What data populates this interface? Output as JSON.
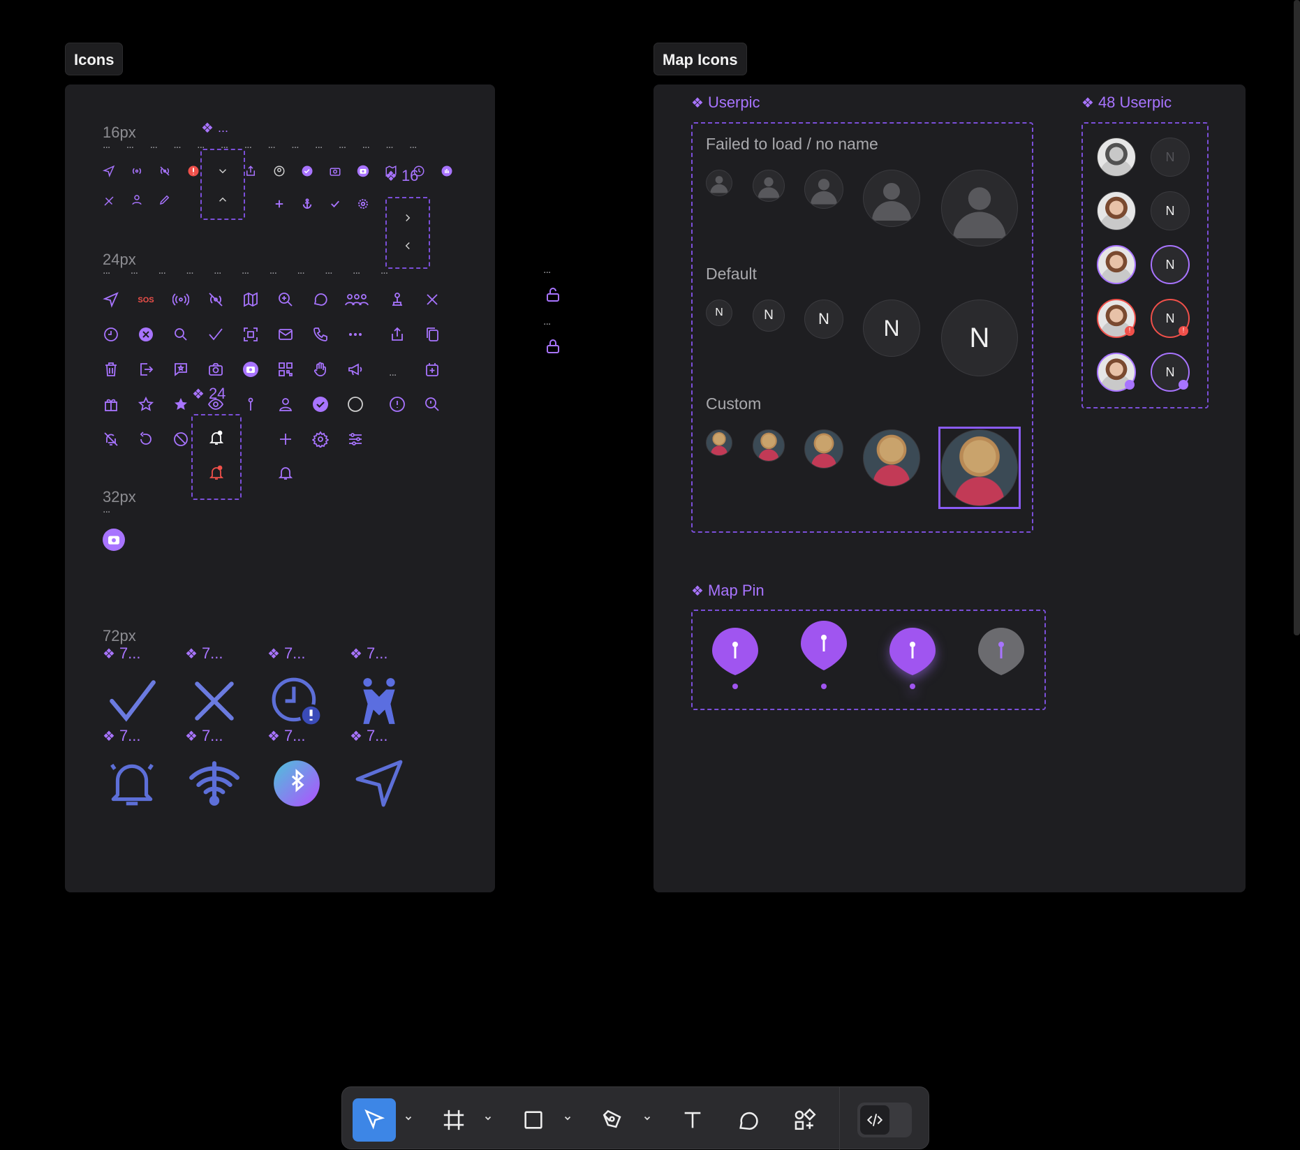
{
  "frames": {
    "icons": {
      "label": "Icons"
    },
    "map_icons": {
      "label": "Map Icons"
    }
  },
  "icons_frame": {
    "size_16": "16px",
    "size_24": "24px",
    "size_32": "32px",
    "size_72": "72px",
    "dots": "...",
    "comp_16_label": "16",
    "comp_24_label": "24",
    "comp_72_label": "7..."
  },
  "userpic": {
    "title": "Userpic",
    "failed_label": "Failed to load / no name",
    "default_label": "Default",
    "custom_label": "Custom",
    "initial": "N"
  },
  "userpic48": {
    "title": "48 Userpic",
    "initial": "N"
  },
  "map_pin": {
    "title": "Map Pin"
  },
  "colors": {
    "accent": "#a874ff",
    "dashed": "#7b4fd9",
    "alert": "#f0504a",
    "bg": "#1e1e21",
    "toolbar_active": "#3d86e6"
  },
  "toolbar": {
    "tools": [
      "move-tool",
      "frame-tool",
      "rectangle-tool",
      "pen-tool",
      "text-tool",
      "comment-tool",
      "components-tool",
      "dev-mode-toggle"
    ]
  }
}
